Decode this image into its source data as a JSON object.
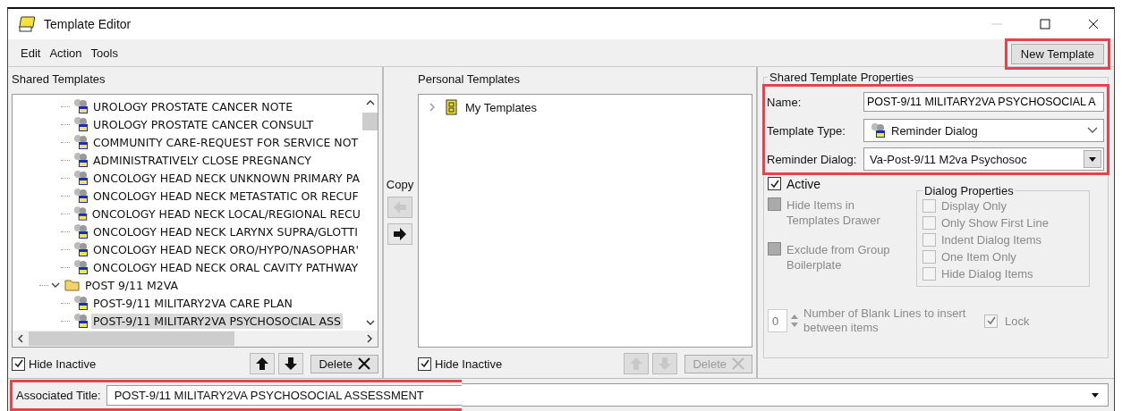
{
  "window": {
    "title": "Template Editor"
  },
  "menu": [
    "Edit",
    "Action",
    "Tools"
  ],
  "new_template_button": "New Template",
  "shared_templates": {
    "label": "Shared Templates",
    "items": [
      {
        "label": "UROLOGY PROSTATE CANCER NOTE",
        "kind": "template",
        "selected": false
      },
      {
        "label": "UROLOGY PROSTATE CANCER CONSULT",
        "kind": "template",
        "selected": false
      },
      {
        "label": "COMMUNITY CARE-REQUEST FOR SERVICE NOT",
        "kind": "template",
        "selected": false
      },
      {
        "label": "ADMINISTRATIVELY CLOSE PREGNANCY",
        "kind": "template",
        "selected": false
      },
      {
        "label": "ONCOLOGY HEAD NECK UNKNOWN PRIMARY PA",
        "kind": "template",
        "selected": false
      },
      {
        "label": "ONCOLOGY HEAD NECK METASTATIC OR RECUF",
        "kind": "template",
        "selected": false
      },
      {
        "label": "ONCOLOGY HEAD NECK LOCAL/REGIONAL RECU",
        "kind": "template",
        "selected": false
      },
      {
        "label": "ONCOLOGY HEAD NECK LARYNX SUPRA/GLOTTI",
        "kind": "template",
        "selected": false
      },
      {
        "label": "ONCOLOGY HEAD NECK ORO/HYPO/NASOPHAR'",
        "kind": "template",
        "selected": false
      },
      {
        "label": "ONCOLOGY HEAD NECK ORAL CAVITY PATHWAY",
        "kind": "template",
        "selected": false
      },
      {
        "label": "POST 9/11 M2VA",
        "kind": "folder",
        "selected": false,
        "expanded": true,
        "children": [
          {
            "label": "POST-9/11 MILITARY2VA CARE PLAN",
            "kind": "template",
            "selected": false
          },
          {
            "label": "POST-9/11 MILITARY2VA PSYCHOSOCIAL ASS",
            "kind": "template",
            "selected": true
          }
        ]
      }
    ],
    "hide_inactive": {
      "label": "Hide Inactive",
      "checked": true
    },
    "delete_button": {
      "label": "Delete",
      "disabled": false
    }
  },
  "copy_label": "Copy",
  "personal_templates": {
    "label": "Personal Templates",
    "items": [
      {
        "label": "My Templates",
        "expanded": false
      }
    ],
    "hide_inactive": {
      "label": "Hide Inactive",
      "checked": true
    },
    "delete_button": {
      "label": "Delete",
      "disabled": true
    }
  },
  "properties": {
    "title": "Shared Template Properties",
    "name": {
      "label": "Name:",
      "value": "POST-9/11 MILITARY2VA PSYCHOSOCIAL A"
    },
    "template_type": {
      "label": "Template Type:",
      "value": "Reminder Dialog"
    },
    "reminder_dialog": {
      "label": "Reminder Dialog:",
      "value": "Va-Post-9/11 M2va Psychosoc"
    },
    "options": [
      {
        "label": "Active",
        "checked": true,
        "disabled": false
      },
      {
        "label": "Hide Items in Templates Drawer",
        "checked": false,
        "disabled": true
      },
      {
        "label": "Exclude from Group Boilerplate",
        "checked": false,
        "disabled": true
      }
    ],
    "dialog_properties": {
      "title": "Dialog Properties",
      "items": [
        {
          "label": "Display Only",
          "checked": false
        },
        {
          "label": "Only Show First Line",
          "checked": false
        },
        {
          "label": "Indent Dialog Items",
          "checked": false
        },
        {
          "label": "One Item Only",
          "checked": false
        },
        {
          "label": "Hide Dialog Items",
          "checked": false
        }
      ]
    },
    "blank_lines": {
      "value": "0",
      "label": "Number of Blank Lines to insert between items"
    },
    "lock": {
      "label": "Lock",
      "checked": true
    }
  },
  "associated_title": {
    "label": "Associated Title:",
    "value": "POST-9/11 MILITARY2VA PSYCHOSOCIAL ASSESSMENT"
  }
}
